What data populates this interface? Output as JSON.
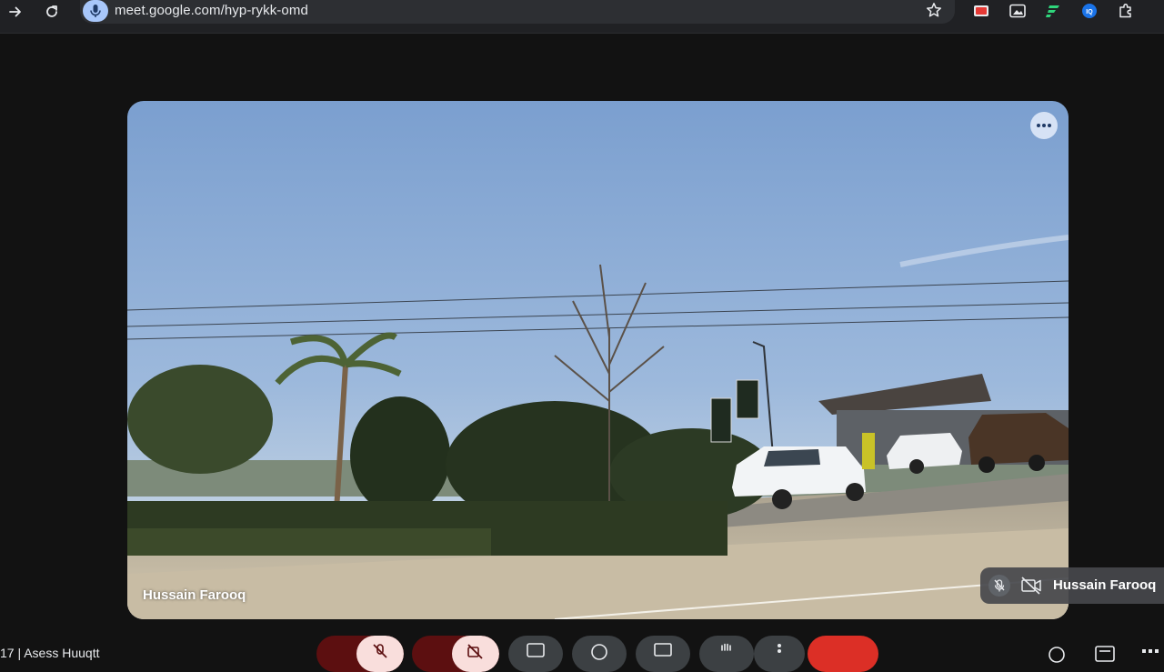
{
  "browser": {
    "url": "meet.google.com/hyp-rykk-omd",
    "icons": [
      "forward-icon",
      "reload-icon",
      "mic-icon",
      "star-icon",
      "youtube-extension-icon",
      "picture-in-picture-icon",
      "extension-f-icon",
      "extension-iq-icon",
      "extensions-puzzle-icon"
    ]
  },
  "meeting": {
    "main_participant": "Hussain Farooq",
    "self_view_name": "Hussain Farooq",
    "self_view_state": {
      "mic": "off",
      "camera": "off"
    }
  },
  "controls": {
    "bottom_left_text": "17 | Asess Huuqtt",
    "icons": [
      "mic-off-icon",
      "camera-off-icon",
      "captions-icon",
      "emoji-icon",
      "present-icon",
      "raise-hand-icon",
      "more-options-icon",
      "end-call-icon",
      "info-icon",
      "people-icon",
      "activities-icon"
    ]
  },
  "colors": {
    "background": "#121212",
    "browser_bar": "#202124",
    "accent_blue": "#a8c7fa",
    "end_call_red": "#dc2f26",
    "muted_control_dark": "#5c0f10",
    "muted_control_light": "#f9dedc"
  }
}
